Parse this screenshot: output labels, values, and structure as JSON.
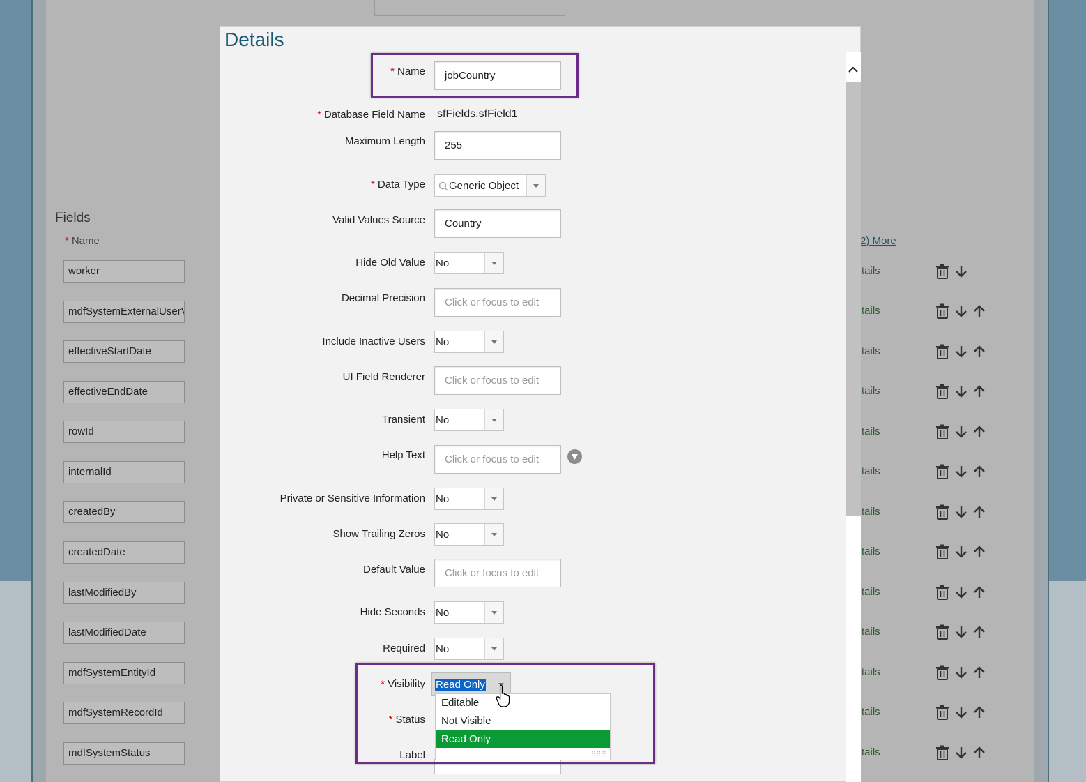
{
  "background": {
    "fields_section": {
      "heading": "Fields",
      "name_column_label": "Name",
      "field_names": [
        "worker",
        "mdfSystemExternalUserV",
        "effectiveStartDate",
        "effectiveEndDate",
        "rowId",
        "internalId",
        "createdBy",
        "createdDate",
        "lastModifiedBy",
        "lastModifiedDate",
        "mdfSystemEntityId",
        "mdfSystemRecordId",
        "mdfSystemStatus"
      ],
      "more_link": "2) More",
      "details_link": "tails"
    }
  },
  "dialog": {
    "title": "Details",
    "form": {
      "name": {
        "label": "Name",
        "value": "jobCountry"
      },
      "database_field_name": {
        "label": "Database Field Name",
        "value": "sfFields.sfField1"
      },
      "maximum_length": {
        "label": "Maximum Length",
        "value": "255"
      },
      "data_type": {
        "label": "Data Type",
        "value": "Generic Object"
      },
      "valid_values_source": {
        "label": "Valid Values Source",
        "value": "Country"
      },
      "hide_old_value": {
        "label": "Hide Old Value",
        "value": "No"
      },
      "decimal_precision": {
        "label": "Decimal Precision",
        "placeholder": "Click or focus to edit"
      },
      "include_inactive_users": {
        "label": "Include Inactive Users",
        "value": "No"
      },
      "ui_field_renderer": {
        "label": "UI Field Renderer",
        "placeholder": "Click or focus to edit"
      },
      "transient": {
        "label": "Transient",
        "value": "No"
      },
      "help_text": {
        "label": "Help Text",
        "placeholder": "Click or focus to edit"
      },
      "private_sensitive": {
        "label": "Private or Sensitive Information",
        "value": "No"
      },
      "show_trailing_zeros": {
        "label": "Show Trailing Zeros",
        "value": "No"
      },
      "default_value": {
        "label": "Default Value",
        "placeholder": "Click or focus to edit"
      },
      "hide_seconds": {
        "label": "Hide Seconds",
        "value": "No"
      },
      "required": {
        "label": "Required",
        "value": "No"
      },
      "visibility": {
        "label": "Visibility",
        "value": "Read Only",
        "options": [
          "Editable",
          "Not Visible",
          "Read Only"
        ],
        "selected_option": "Read Only"
      },
      "status": {
        "label": "Status"
      },
      "label": {
        "label": "Label"
      }
    },
    "required_marker": "*"
  },
  "colors": {
    "title": "#1c5a78",
    "highlight_border": "#6a2e88",
    "selected_option": "#0a9a36",
    "required": "#cc0000"
  }
}
